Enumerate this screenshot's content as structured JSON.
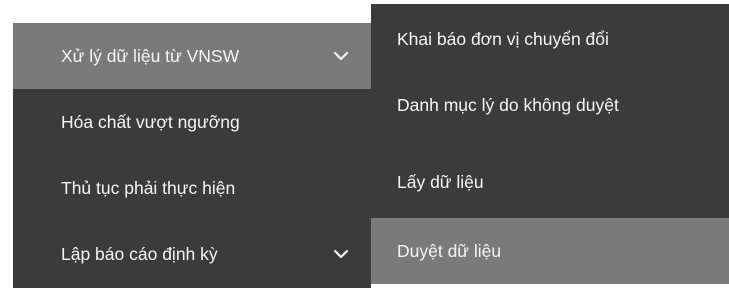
{
  "colors": {
    "menu_bg": "#3b3b3b",
    "highlight_bg": "#7a7a7a",
    "text": "#f4f4f4"
  },
  "main_menu": {
    "items": [
      {
        "label": "Xử lý dữ liệu từ VNSW",
        "has_submenu": true,
        "active": true,
        "icon": "chevron-down-icon"
      },
      {
        "label": "Hóa chất vượt ngưỡng",
        "has_submenu": false,
        "active": false
      },
      {
        "label": "Thủ tục phải thực hiện",
        "has_submenu": false,
        "active": false
      },
      {
        "label": "Lập báo cáo định kỳ",
        "has_submenu": true,
        "active": false,
        "icon": "chevron-down-icon"
      }
    ]
  },
  "sub_menu": {
    "items": [
      {
        "label": "Khai báo đơn vị chuyển đổi",
        "active": false
      },
      {
        "label": "Danh mục lý do không duyệt",
        "active": false
      },
      {
        "label": "Lấy dữ liệu",
        "active": false
      },
      {
        "label": "Duyệt dữ liệu",
        "active": true
      }
    ]
  }
}
